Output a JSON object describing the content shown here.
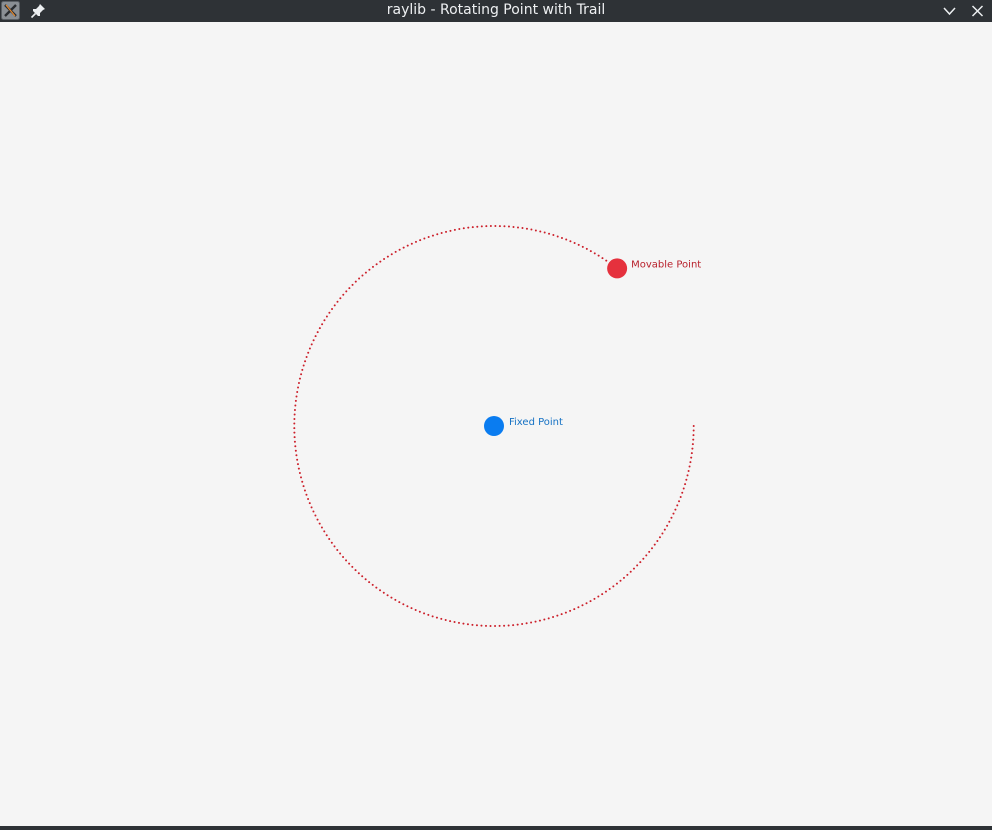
{
  "window": {
    "title": "raylib - Rotating Point with Trail",
    "app_icon": "raylib-app-icon",
    "pin_icon": "pin-icon",
    "minimize_icon": "chevron-down-icon",
    "close_icon": "close-icon"
  },
  "scene": {
    "background_color": "#f5f5f5",
    "trail_color": "#cc1f2a",
    "fixed_point": {
      "label": "Fixed Point",
      "color": "#0a7cf0",
      "label_color": "#1672c4"
    },
    "movable_point": {
      "label": "Movable Point",
      "color": "#e5313d",
      "label_color": "#b8212c",
      "angle_deg": -52
    },
    "trail": {
      "from_angle_deg": 0,
      "to_angle_deg": -52,
      "direction": "clockwise"
    }
  }
}
